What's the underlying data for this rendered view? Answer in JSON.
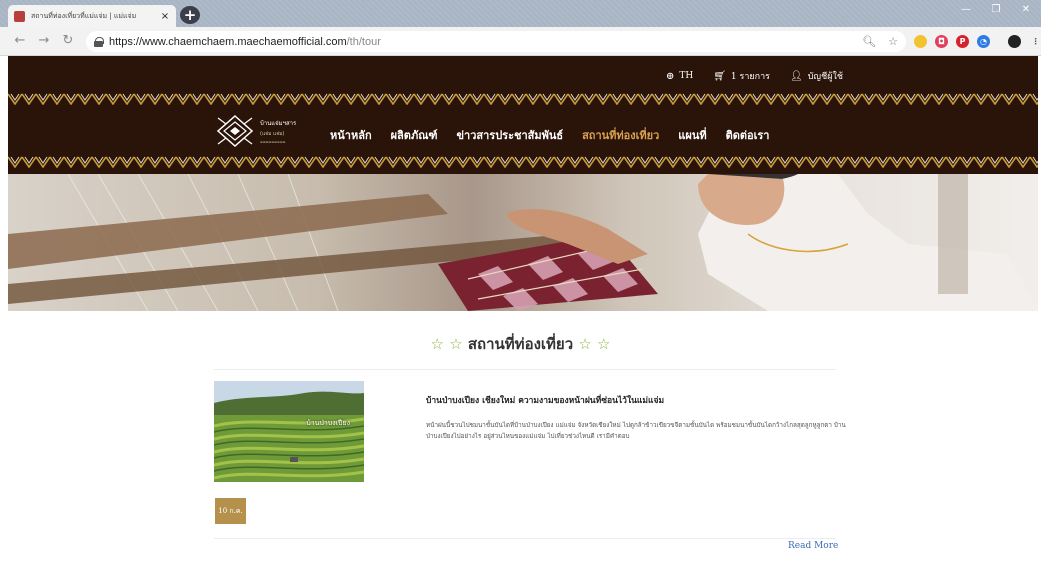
{
  "browser": {
    "tab_title": "สถานที่ท่องเที่ยวที่แม่แจ่ม | แม่แจ่ม",
    "tab_close": "×",
    "new_tab": "+",
    "url_host": "https://www.chaemchaem.maechaemofficial.com",
    "url_path": "/th/tour",
    "window_controls": [
      "—",
      "❐",
      "✕"
    ],
    "nav_icons": [
      "back-icon",
      "forward-icon",
      "reload-icon"
    ]
  },
  "header": {
    "language": "TH",
    "cart": "1 รายการ",
    "account": "บัญชีผู้ใช้",
    "colors": {
      "background": "#2a1308",
      "active": "#d8a050"
    }
  },
  "logo": {
    "line1": "บ้านแจ่มฯสาร",
    "line2": "(แจ่ม แจ่ม)"
  },
  "nav": {
    "items": [
      {
        "label": "หน้าหลัก",
        "active": false
      },
      {
        "label": "ผลิตภัณฑ์",
        "active": false
      },
      {
        "label": "ข่าวสารประชาสัมพันธ์",
        "active": false
      },
      {
        "label": "สถานที่ท่องเที่ยว",
        "active": true
      },
      {
        "label": "แผนที่",
        "active": false
      },
      {
        "label": "ติดต่อเรา",
        "active": false
      }
    ]
  },
  "section": {
    "title": "สถานที่ท่องเที่ยว",
    "star": "☆"
  },
  "article": {
    "thumb_caption": "บ้านป่าบงเปียง",
    "title": "บ้านป่าบงเปียง เชียงใหม่ ความงามของหน้าฝนที่ซ่อนไว้ในแม่แจ่ม",
    "body": "หน้าฝนนี้ชวนไปชมนาขั้นบันไดที่บ้านป่าบงเปียง แม่แจ่ม จังหวัดเชียงใหม่ ไปดูกล้าข้าวเขียวขจีตามขั้นบันได พร้อมชมนาขั้นบันไดกว้างไกลสุดลูกหูลูกตา บ้านป่าบงเปียงไปอย่างไร อยู่ส่วนไหนของแม่แจ่ม ไปเที่ยวช่วงไหนดี เรามีคำตอบ",
    "date": "10 ก.ค.",
    "read_more": "Read More"
  }
}
